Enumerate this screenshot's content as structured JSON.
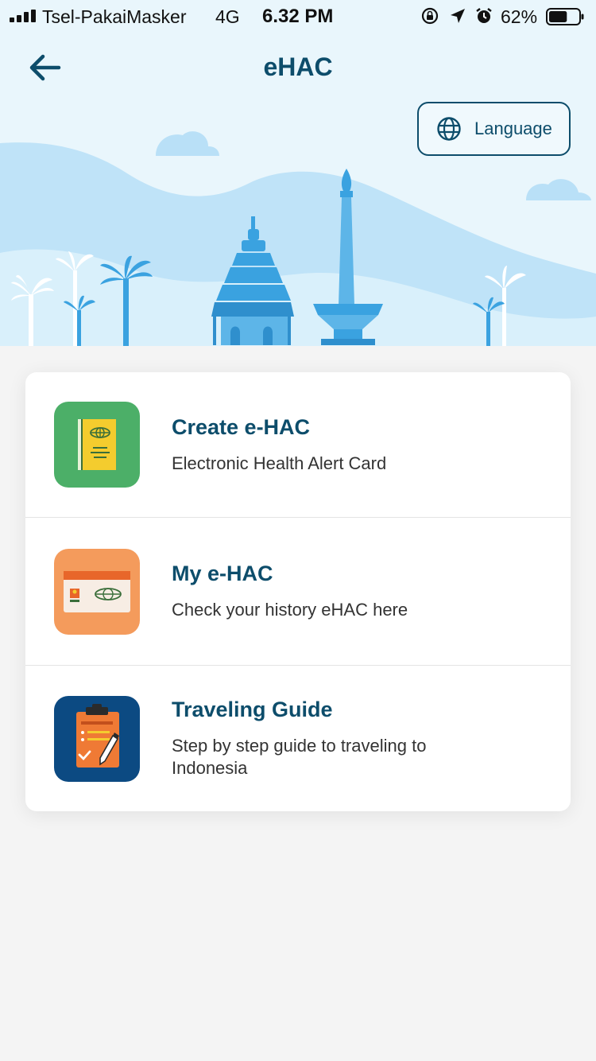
{
  "status_bar": {
    "carrier": "Tsel-PakaiMasker",
    "network": "4G",
    "time": "6.32 PM",
    "battery_percent": "62%",
    "battery_level": 0.62
  },
  "header": {
    "title": "eHAC",
    "language_button": "Language"
  },
  "menu": [
    {
      "title": "Create e-HAC",
      "description": "Electronic Health Alert Card",
      "icon": "health-card-icon",
      "tile_color": "#4caf68"
    },
    {
      "title": "My e-HAC",
      "description": "Check your history eHAC here",
      "icon": "id-card-icon",
      "tile_color": "#f49b5c"
    },
    {
      "title": "Traveling Guide",
      "description": "Step by step guide to traveling to Indonesia",
      "icon": "clipboard-icon",
      "tile_color": "#0c4a82"
    }
  ],
  "colors": {
    "primary": "#0d4d6b",
    "hero_background": "#e9f6fc",
    "illustration_blue": "#3aa2e0"
  }
}
